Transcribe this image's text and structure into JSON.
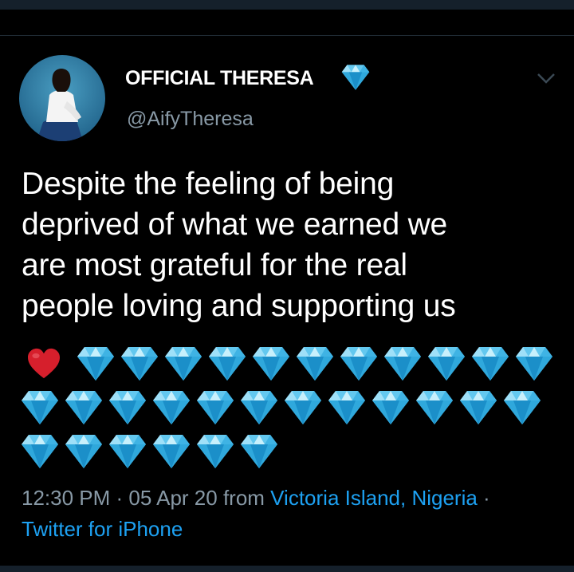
{
  "tweet": {
    "author": {
      "display_name": "OFFICIAL THERESA",
      "handle": "@AifyTheresa",
      "badge_icon": "blue-diamond-icon"
    },
    "text_lines": [
      "Despite the feeling of being",
      "deprived of what we earned we",
      "are most grateful for the real",
      "people loving and supporting us"
    ],
    "emojis": {
      "first": "red-heart-icon",
      "repeated": "blue-diamond-icon",
      "diamond_count": 29
    },
    "meta": {
      "time": "12:30 PM",
      "separator": " · ",
      "date": "05 Apr 20",
      "from_text": " from ",
      "location": "Victoria Island, Nigeria",
      "trailing_separator": " ·",
      "client": "Twitter for iPhone"
    }
  },
  "colors": {
    "background": "#000000",
    "text": "#ffffff",
    "secondary_text": "#8899a6",
    "link": "#1da1f2",
    "diamond": "#5bc7f0",
    "heart": "#d61f2c"
  }
}
